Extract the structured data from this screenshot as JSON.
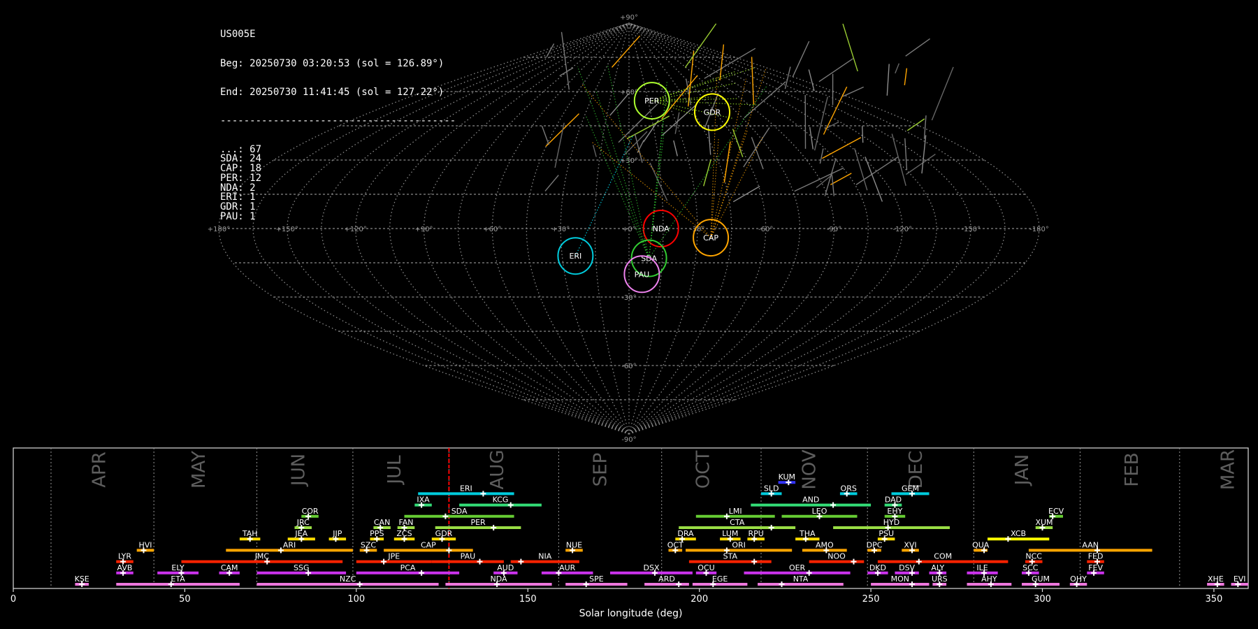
{
  "info": {
    "station": "US005E",
    "begin": "Beg: 20250730 03:20:53 (sol = 126.89°)",
    "end": "End: 20250730 11:41:45 (sol = 127.22°)",
    "separator": "----------------------------------------",
    "counts": [
      {
        "code": "...",
        "n": 67
      },
      {
        "code": "SDA",
        "n": 24
      },
      {
        "code": "CAP",
        "n": 18
      },
      {
        "code": "PER",
        "n": 12
      },
      {
        "code": "NDA",
        "n": 2
      },
      {
        "code": "ERI",
        "n": 1
      },
      {
        "code": "GDR",
        "n": 1
      },
      {
        "code": "PAU",
        "n": 1
      }
    ]
  },
  "chart_data": [
    {
      "type": "scatter",
      "projection": "sinusoidal",
      "lon_ticks": [
        "+180°",
        "+150°",
        "+120°",
        "+90°",
        "+60°",
        "+30°",
        "+0°",
        "-30°",
        "-60°",
        "-90°",
        "-120°",
        "-150°",
        "-180°"
      ],
      "lat_ticks": [
        "+90°",
        "+60°",
        "+30°",
        "-30°",
        "-60°",
        "-90°"
      ],
      "grid": true,
      "showers": [
        {
          "code": "PER",
          "lon": -18,
          "lat": 56,
          "color": "#adff2f"
        },
        {
          "code": "GDR",
          "lon": -58,
          "lat": 51,
          "color": "#ffff00"
        },
        {
          "code": "NDA",
          "lon": -14,
          "lat": 0,
          "color": "#ff0000"
        },
        {
          "code": "CAP",
          "lon": -36,
          "lat": -4,
          "color": "#ffa500"
        },
        {
          "code": "SDA",
          "lon": -9,
          "lat": -13,
          "color": "#33cc33"
        },
        {
          "code": "ERI",
          "lon": 24,
          "lat": -12,
          "color": "#00ccdd"
        },
        {
          "code": "PAU",
          "lon": -6,
          "lat": -20,
          "color": "#ee82ee"
        }
      ]
    },
    {
      "type": "timeline",
      "xlabel": "Solar longitude (deg)",
      "xlim": [
        0,
        360
      ],
      "x_ticks": [
        0,
        50,
        100,
        150,
        200,
        250,
        300,
        350
      ],
      "current_sol": 127.0,
      "month_boundaries": [
        11,
        41,
        71,
        99,
        127,
        159,
        189,
        218,
        249,
        280,
        311,
        340
      ],
      "months": [
        {
          "label": "APR",
          "sol": 25
        },
        {
          "label": "MAY",
          "sol": 54
        },
        {
          "label": "JUN",
          "sol": 83
        },
        {
          "label": "JUL",
          "sol": 111
        },
        {
          "label": "AUG",
          "sol": 141
        },
        {
          "label": "SEP",
          "sol": 171
        },
        {
          "label": "OCT",
          "sol": 201
        },
        {
          "label": "NOV",
          "sol": 232
        },
        {
          "label": "DEC",
          "sol": 263
        },
        {
          "label": "JAN",
          "sol": 294
        },
        {
          "label": "FEB",
          "sol": 326
        },
        {
          "label": "MAR",
          "sol": 354
        }
      ],
      "showers": [
        {
          "code": "KUM",
          "start": 223,
          "end": 228,
          "peak": 226,
          "row": 11,
          "color": "#3333ff"
        },
        {
          "code": "ERI",
          "start": 118,
          "end": 146,
          "peak": 137,
          "row": 10,
          "color": "#00ccdd"
        },
        {
          "code": "SLD",
          "start": 218,
          "end": 224,
          "peak": 221,
          "row": 10,
          "color": "#00ccdd"
        },
        {
          "code": "ORS",
          "start": 241,
          "end": 246,
          "peak": 243,
          "row": 10,
          "color": "#00ccdd"
        },
        {
          "code": "GEM",
          "start": 256,
          "end": 267,
          "peak": 262,
          "row": 10,
          "color": "#00ccdd"
        },
        {
          "code": "IXA",
          "start": 117,
          "end": 122,
          "peak": 119,
          "row": 9,
          "color": "#33dd77"
        },
        {
          "code": "KCG",
          "start": 130,
          "end": 154,
          "peak": 145,
          "row": 9,
          "color": "#33dd77"
        },
        {
          "code": "AND",
          "start": 215,
          "end": 250,
          "peak": 239,
          "row": 9,
          "color": "#33dd77"
        },
        {
          "code": "DAD",
          "start": 254,
          "end": 259,
          "peak": 257,
          "row": 9,
          "color": "#33dd77"
        },
        {
          "code": "SDA",
          "start": 114,
          "end": 146,
          "peak": 126,
          "row": 8,
          "color": "#66cc33"
        },
        {
          "code": "LMI",
          "start": 199,
          "end": 222,
          "peak": 208,
          "row": 8,
          "color": "#66cc33"
        },
        {
          "code": "LEO",
          "start": 224,
          "end": 246,
          "peak": 235,
          "row": 8,
          "color": "#66cc33"
        },
        {
          "code": "EHY",
          "start": 254,
          "end": 260,
          "peak": 257,
          "row": 8,
          "color": "#66cc33"
        },
        {
          "code": "ECV",
          "start": 302,
          "end": 306,
          "peak": 303,
          "row": 8,
          "color": "#66cc33"
        },
        {
          "code": "COR",
          "start": 84,
          "end": 89,
          "peak": 86,
          "row": 8,
          "color": "#66cc33"
        },
        {
          "code": "JRC",
          "start": 82,
          "end": 87,
          "peak": 84,
          "row": 7,
          "color": "#99dd44"
        },
        {
          "code": "CAN",
          "start": 105,
          "end": 110,
          "peak": 107,
          "row": 7,
          "color": "#99dd44"
        },
        {
          "code": "FAN",
          "start": 112,
          "end": 117,
          "peak": 114,
          "row": 7,
          "color": "#99dd44"
        },
        {
          "code": "PER",
          "start": 123,
          "end": 148,
          "peak": 140,
          "row": 7,
          "color": "#99dd44"
        },
        {
          "code": "CTA",
          "start": 194,
          "end": 228,
          "peak": 221,
          "row": 7,
          "color": "#99dd44"
        },
        {
          "code": "HYD",
          "start": 239,
          "end": 273,
          "peak": 255,
          "row": 7,
          "color": "#99dd44"
        },
        {
          "code": "XUM",
          "start": 298,
          "end": 303,
          "peak": 300,
          "row": 7,
          "color": "#99dd44"
        },
        {
          "code": "TAH",
          "start": 66,
          "end": 72,
          "peak": 69,
          "row": 6,
          "color": "#ffdd00"
        },
        {
          "code": "JEA",
          "start": 80,
          "end": 88,
          "peak": 84,
          "row": 6,
          "color": "#ffdd00"
        },
        {
          "code": "JIP",
          "start": 92,
          "end": 97,
          "peak": 94,
          "row": 6,
          "color": "#ffdd00"
        },
        {
          "code": "PPS",
          "start": 104,
          "end": 108,
          "peak": 106,
          "row": 6,
          "color": "#ffdd00"
        },
        {
          "code": "ZCS",
          "start": 111,
          "end": 117,
          "peak": 114,
          "row": 6,
          "color": "#ffdd00"
        },
        {
          "code": "GDR",
          "start": 122,
          "end": 129,
          "peak": 125,
          "row": 6,
          "color": "#ffdd00"
        },
        {
          "code": "DRA",
          "start": 193,
          "end": 199,
          "peak": 195,
          "row": 6,
          "color": "#ffdd00"
        },
        {
          "code": "LUM",
          "start": 206,
          "end": 212,
          "peak": 209,
          "row": 6,
          "color": "#ffdd00"
        },
        {
          "code": "RPU",
          "start": 214,
          "end": 219,
          "peak": 216,
          "row": 6,
          "color": "#ffdd00"
        },
        {
          "code": "THA",
          "start": 228,
          "end": 235,
          "peak": 231,
          "row": 6,
          "color": "#ffdd00"
        },
        {
          "code": "PSU",
          "start": 252,
          "end": 257,
          "peak": 254,
          "row": 6,
          "color": "#ffdd00"
        },
        {
          "code": "XCB",
          "start": 284,
          "end": 302,
          "peak": 290,
          "row": 6,
          "color": "#ffff00"
        },
        {
          "code": "HVI",
          "start": 36,
          "end": 41,
          "peak": 38,
          "row": 5,
          "color": "#ffa500"
        },
        {
          "code": "ARI",
          "start": 62,
          "end": 99,
          "peak": 78,
          "row": 5,
          "color": "#ffa500"
        },
        {
          "code": "SZC",
          "start": 101,
          "end": 106,
          "peak": 103,
          "row": 5,
          "color": "#ffa500"
        },
        {
          "code": "CAP",
          "start": 108,
          "end": 134,
          "peak": 127,
          "row": 5,
          "color": "#ffa500"
        },
        {
          "code": "NUE",
          "start": 161,
          "end": 166,
          "peak": 163,
          "row": 5,
          "color": "#ffa500"
        },
        {
          "code": "OCT",
          "start": 191,
          "end": 195,
          "peak": 193,
          "row": 5,
          "color": "#ffa500"
        },
        {
          "code": "ORI",
          "start": 196,
          "end": 227,
          "peak": 208,
          "row": 5,
          "color": "#ffa500"
        },
        {
          "code": "AMO",
          "start": 230,
          "end": 243,
          "peak": 237,
          "row": 5,
          "color": "#ffa500"
        },
        {
          "code": "DPC",
          "start": 249,
          "end": 253,
          "peak": 251,
          "row": 5,
          "color": "#ffa500"
        },
        {
          "code": "XVI",
          "start": 259,
          "end": 264,
          "peak": 262,
          "row": 5,
          "color": "#ffa500"
        },
        {
          "code": "QUA",
          "start": 280,
          "end": 284,
          "peak": 283,
          "row": 5,
          "color": "#ffa500"
        },
        {
          "code": "AAN",
          "start": 296,
          "end": 332,
          "peak": 316,
          "row": 5,
          "color": "#ffa500"
        },
        {
          "code": "LYR",
          "start": 30,
          "end": 35,
          "peak": 32,
          "row": 4,
          "color": "#ff2200"
        },
        {
          "code": "JMC",
          "start": 49,
          "end": 96,
          "peak": 74,
          "row": 4,
          "color": "#ff2200"
        },
        {
          "code": "JPE",
          "start": 100,
          "end": 122,
          "peak": 108,
          "row": 4,
          "color": "#ff2200"
        },
        {
          "code": "PAU",
          "start": 122,
          "end": 143,
          "peak": 136,
          "row": 4,
          "color": "#ff2200"
        },
        {
          "code": "NIA",
          "start": 145,
          "end": 165,
          "peak": 148,
          "row": 4,
          "color": "#ff2200"
        },
        {
          "code": "STA",
          "start": 197,
          "end": 221,
          "peak": 216,
          "row": 4,
          "color": "#ff2200"
        },
        {
          "code": "NOO",
          "start": 232,
          "end": 248,
          "peak": 245,
          "row": 4,
          "color": "#ff2200"
        },
        {
          "code": "COM",
          "start": 252,
          "end": 290,
          "peak": 264,
          "row": 4,
          "color": "#ff2200"
        },
        {
          "code": "NCC",
          "start": 295,
          "end": 300,
          "peak": 297,
          "row": 4,
          "color": "#ff2200"
        },
        {
          "code": "FED",
          "start": 313,
          "end": 318,
          "peak": 316,
          "row": 4,
          "color": "#ff2200"
        },
        {
          "code": "AVB",
          "start": 30,
          "end": 35,
          "peak": 32,
          "row": 3,
          "color": "#cc33ee"
        },
        {
          "code": "ELY",
          "start": 42,
          "end": 54,
          "peak": 49,
          "row": 3,
          "color": "#cc33ee"
        },
        {
          "code": "CAM",
          "start": 60,
          "end": 66,
          "peak": 63,
          "row": 3,
          "color": "#cc33ee"
        },
        {
          "code": "SSG",
          "start": 71,
          "end": 97,
          "peak": 86,
          "row": 3,
          "color": "#cc33ee"
        },
        {
          "code": "PCA",
          "start": 100,
          "end": 130,
          "peak": 119,
          "row": 3,
          "color": "#cc33ee"
        },
        {
          "code": "AUD",
          "start": 140,
          "end": 147,
          "peak": 143,
          "row": 3,
          "color": "#cc33ee"
        },
        {
          "code": "AUR",
          "start": 154,
          "end": 169,
          "peak": 159,
          "row": 3,
          "color": "#cc33ee"
        },
        {
          "code": "DSX",
          "start": 174,
          "end": 198,
          "peak": 187,
          "row": 3,
          "color": "#cc33ee"
        },
        {
          "code": "OCU",
          "start": 199,
          "end": 205,
          "peak": 202,
          "row": 3,
          "color": "#cc33ee"
        },
        {
          "code": "OER",
          "start": 213,
          "end": 244,
          "peak": 232,
          "row": 3,
          "color": "#cc33ee"
        },
        {
          "code": "DKD",
          "start": 249,
          "end": 255,
          "peak": 252,
          "row": 3,
          "color": "#cc33ee"
        },
        {
          "code": "DSV",
          "start": 257,
          "end": 264,
          "peak": 262,
          "row": 3,
          "color": "#cc33ee"
        },
        {
          "code": "ALY",
          "start": 267,
          "end": 272,
          "peak": 270,
          "row": 3,
          "color": "#cc33ee"
        },
        {
          "code": "ILE",
          "start": 278,
          "end": 287,
          "peak": 283,
          "row": 3,
          "color": "#cc33ee"
        },
        {
          "code": "SCC",
          "start": 294,
          "end": 299,
          "peak": 296,
          "row": 3,
          "color": "#cc33ee"
        },
        {
          "code": "FEV",
          "start": 313,
          "end": 318,
          "peak": 315,
          "row": 3,
          "color": "#cc33ee"
        },
        {
          "code": "KSE",
          "start": 18,
          "end": 22,
          "peak": 20,
          "row": 2,
          "color": "#ee77dd"
        },
        {
          "code": "ETA",
          "start": 30,
          "end": 66,
          "peak": 46,
          "row": 2,
          "color": "#ee77dd"
        },
        {
          "code": "NZC",
          "start": 71,
          "end": 124,
          "peak": 101,
          "row": 2,
          "color": "#ee77dd"
        },
        {
          "code": "NDA",
          "start": 126,
          "end": 157,
          "peak": 141,
          "row": 2,
          "color": "#ee77dd"
        },
        {
          "code": "SPE",
          "start": 161,
          "end": 179,
          "peak": 167,
          "row": 2,
          "color": "#ee77dd"
        },
        {
          "code": "ARD",
          "start": 184,
          "end": 197,
          "peak": 194,
          "row": 2,
          "color": "#ee77dd"
        },
        {
          "code": "EGE",
          "start": 198,
          "end": 214,
          "peak": 204,
          "row": 2,
          "color": "#ee77dd"
        },
        {
          "code": "NTA",
          "start": 217,
          "end": 242,
          "peak": 224,
          "row": 2,
          "color": "#ee77dd"
        },
        {
          "code": "MON",
          "start": 250,
          "end": 267,
          "peak": 262,
          "row": 2,
          "color": "#ee77dd"
        },
        {
          "code": "URS",
          "start": 268,
          "end": 272,
          "peak": 270,
          "row": 2,
          "color": "#ee77dd"
        },
        {
          "code": "AHY",
          "start": 278,
          "end": 291,
          "peak": 285,
          "row": 2,
          "color": "#ee77dd"
        },
        {
          "code": "GUM",
          "start": 294,
          "end": 305,
          "peak": 298,
          "row": 2,
          "color": "#ee77dd"
        },
        {
          "code": "OHY",
          "start": 308,
          "end": 313,
          "peak": 310,
          "row": 2,
          "color": "#ee77dd"
        },
        {
          "code": "XHE",
          "start": 348,
          "end": 353,
          "peak": 351,
          "row": 2,
          "color": "#ee77dd"
        },
        {
          "code": "EVI",
          "start": 355,
          "end": 360,
          "peak": 357,
          "row": 2,
          "color": "#ee77dd"
        }
      ]
    }
  ]
}
